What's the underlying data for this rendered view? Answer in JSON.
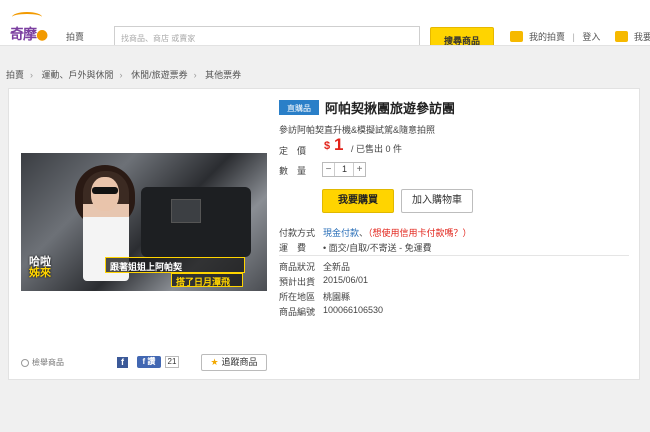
{
  "header": {
    "logo_text": "奇摩",
    "nav_label": "拍賣",
    "search_placeholder": "找商品、商店 或賣家",
    "search_button": "搜尋商品",
    "links": [
      "我的拍賣",
      "登入",
      "我要賣東西"
    ]
  },
  "breadcrumb": [
    "拍賣",
    "運動、戶外與休閒",
    "休閒/旅遊票券",
    "其他票券"
  ],
  "product": {
    "badge": "直購品",
    "title": "阿帕契揪團旅遊參訪團",
    "subtitle": "參訪阿帕契直升機&模擬試駕&隨意拍照",
    "image_caption_1": "跟著姐姐上阿帕契",
    "image_caption_2": "搭了日月潭飛",
    "image_show_logo_1": "哈啦",
    "image_show_logo_2": "姊來",
    "price_label": "定　價",
    "price_currency": "$",
    "price_value": "1",
    "sold_text": "/ 已售出 0 件",
    "qty_label": "數　量",
    "qty_minus": "−",
    "qty_value": "1",
    "qty_plus": "+",
    "buy_button": "我要購買",
    "cart_button": "加入購物車",
    "payment_label": "付款方式",
    "payment_value": "現金付款",
    "payment_sep": "、",
    "payment_question": "（想使用信用卡付款嗎？）",
    "shipping_label": "運　費",
    "shipping_value": "• 面交/自取/不寄送 - 免運費",
    "details": [
      {
        "label": "商品狀況",
        "value": "全新品"
      },
      {
        "label": "預計出貨",
        "value": "2015/06/01"
      },
      {
        "label": "所在地區",
        "value": "桃園縣"
      },
      {
        "label": "商品編號",
        "value": "100066106530"
      }
    ]
  },
  "footer": {
    "report_text": "檢舉商品",
    "fb_icon": "f",
    "like_label": "f 讚",
    "like_count": "21",
    "favorite_button": "追蹤商品"
  },
  "colors": {
    "accent_yellow": "#ffd400",
    "price_red": "#e2231a",
    "badge_blue": "#2a7fc8",
    "link_blue": "#2a6fb8"
  }
}
